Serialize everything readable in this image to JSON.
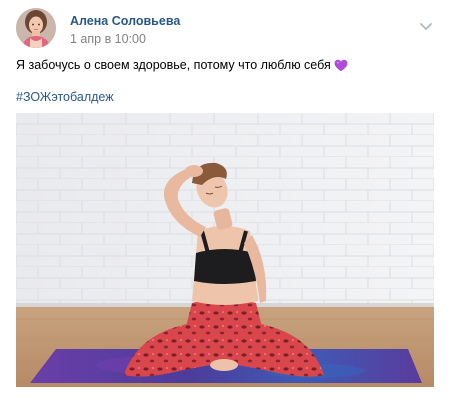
{
  "post": {
    "author_name": "Алена Соловьева",
    "date": "1 апр в 10:00",
    "text": "Я забочусь о своем здоровье, потому что люблю себя",
    "emoji_icon": "purple-heart-icon",
    "hashtag": "#ЗОЖэтобалдеж",
    "photo_icon": "yoga-photo",
    "colors": {
      "link": "#2a5885",
      "meta": "#828282",
      "heart": "#b04ad8",
      "mat": "#4d3c9a",
      "leggings": "#d9464b"
    }
  }
}
